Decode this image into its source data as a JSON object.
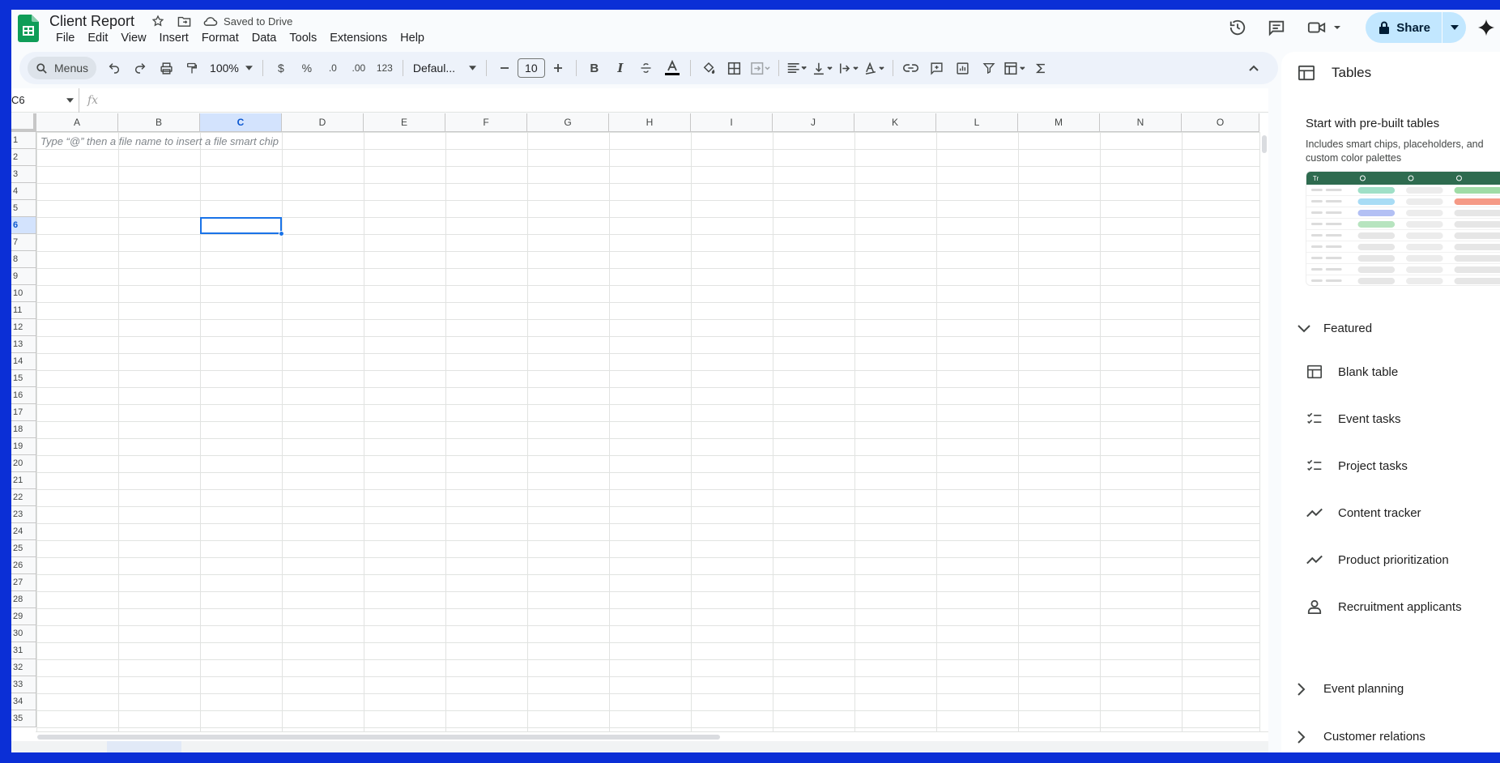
{
  "doc": {
    "title": "Client Report",
    "saved_status": "Saved to Drive"
  },
  "menu": [
    "File",
    "Edit",
    "View",
    "Insert",
    "Format",
    "Data",
    "Tools",
    "Extensions",
    "Help"
  ],
  "header": {
    "share_label": "Share"
  },
  "toolbar": {
    "search_label": "Menus",
    "zoom": "100%",
    "currency": "$",
    "percent": "%",
    "decrease_decimal": ".0",
    "increase_decimal": ".00",
    "number_format": "123",
    "font": "Defaul...",
    "font_size": "10",
    "bold": "B",
    "italic": "I"
  },
  "formula_bar": {
    "cell_ref": "C6",
    "fx": "fx"
  },
  "grid": {
    "columns": [
      "A",
      "B",
      "C",
      "D",
      "E",
      "F",
      "G",
      "H",
      "I",
      "J",
      "K",
      "L",
      "M",
      "N",
      "O"
    ],
    "selected_column": "C",
    "rows": [
      "1",
      "2",
      "3",
      "4",
      "5",
      "6",
      "7",
      "8",
      "9",
      "10",
      "11",
      "12",
      "13",
      "14",
      "15",
      "16",
      "17",
      "18",
      "19",
      "20",
      "21",
      "22",
      "23",
      "24",
      "25",
      "26",
      "27",
      "28",
      "29",
      "30",
      "31",
      "32",
      "33",
      "34",
      "35"
    ],
    "selected_row": "6",
    "hint": "Type “@” then a file name to insert a file smart chip"
  },
  "side_panel": {
    "title": "Tables",
    "subtitle": "Start with pre-built tables",
    "description": "Includes smart chips, placeholders, and custom color palettes",
    "featured_label": "Featured",
    "items": [
      {
        "label": "Blank table",
        "icon": "table-icon"
      },
      {
        "label": "Event tasks",
        "icon": "checklist-icon"
      },
      {
        "label": "Project tasks",
        "icon": "checklist-icon"
      },
      {
        "label": "Content tracker",
        "icon": "trend-icon"
      },
      {
        "label": "Product prioritization",
        "icon": "trend-icon"
      },
      {
        "label": "Recruitment applicants",
        "icon": "person-icon"
      }
    ],
    "sections": [
      "Event planning",
      "Customer relations"
    ]
  },
  "colors": {
    "accent": "#1a73e8",
    "share_bg": "#c2e7ff",
    "toolbar_bg": "#edf2fa",
    "sheets_green": "#0f9d58"
  }
}
